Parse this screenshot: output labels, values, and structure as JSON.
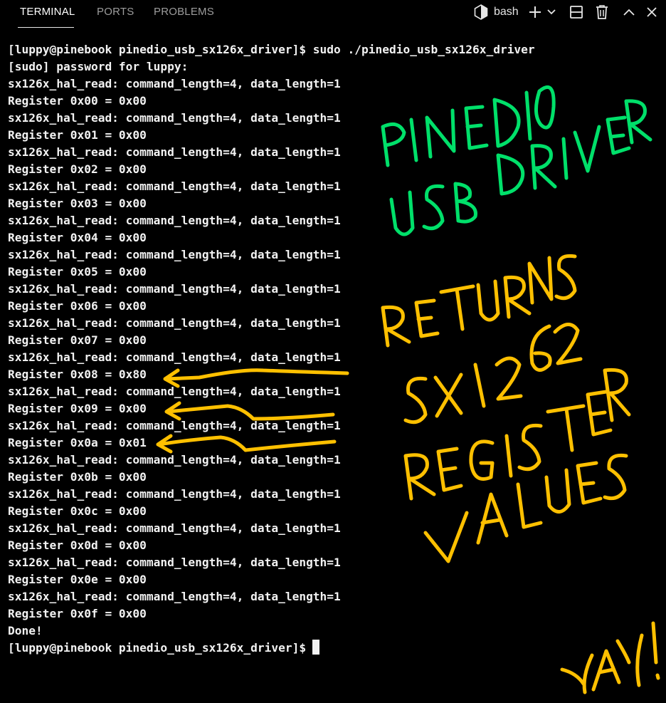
{
  "tabs": [
    {
      "label": "TERMINAL",
      "active": true
    },
    {
      "label": "PORTS",
      "active": false
    },
    {
      "label": "PROBLEMS",
      "active": false
    }
  ],
  "toolbar": {
    "shell_label": "bash",
    "icons": [
      "terminal-profile-icon",
      "new-terminal-icon",
      "dropdown-icon",
      "split-terminal-icon",
      "trash-icon",
      "maximize-panel-icon",
      "close-panel-icon"
    ]
  },
  "terminal": {
    "lines": [
      "[luppy@pinebook pinedio_usb_sx126x_driver]$ sudo ./pinedio_usb_sx126x_driver",
      "[sudo] password for luppy:",
      "sx126x_hal_read: command_length=4, data_length=1",
      "Register 0x00 = 0x00",
      "sx126x_hal_read: command_length=4, data_length=1",
      "Register 0x01 = 0x00",
      "sx126x_hal_read: command_length=4, data_length=1",
      "Register 0x02 = 0x00",
      "sx126x_hal_read: command_length=4, data_length=1",
      "Register 0x03 = 0x00",
      "sx126x_hal_read: command_length=4, data_length=1",
      "Register 0x04 = 0x00",
      "sx126x_hal_read: command_length=4, data_length=1",
      "Register 0x05 = 0x00",
      "sx126x_hal_read: command_length=4, data_length=1",
      "Register 0x06 = 0x00",
      "sx126x_hal_read: command_length=4, data_length=1",
      "Register 0x07 = 0x00",
      "sx126x_hal_read: command_length=4, data_length=1",
      "Register 0x08 = 0x80",
      "sx126x_hal_read: command_length=4, data_length=1",
      "Register 0x09 = 0x00",
      "sx126x_hal_read: command_length=4, data_length=1",
      "Register 0x0a = 0x01",
      "sx126x_hal_read: command_length=4, data_length=1",
      "Register 0x0b = 0x00",
      "sx126x_hal_read: command_length=4, data_length=1",
      "Register 0x0c = 0x00",
      "sx126x_hal_read: command_length=4, data_length=1",
      "Register 0x0d = 0x00",
      "sx126x_hal_read: command_length=4, data_length=1",
      "Register 0x0e = 0x00",
      "sx126x_hal_read: command_length=4, data_length=1",
      "Register 0x0f = 0x00",
      "Done!"
    ],
    "prompt": "[luppy@pinebook pinedio_usb_sx126x_driver]$"
  },
  "annotations": {
    "green_text": [
      "PINEDIO",
      "USB DRIVER"
    ],
    "yellow_text": [
      "RETURNS",
      "SX1262",
      "REGISTER",
      "VALUES",
      "YAY!"
    ],
    "colors": {
      "green": "#00e06a",
      "yellow": "#ffc000",
      "background": "#000000",
      "text": "#f2f2f2"
    }
  }
}
